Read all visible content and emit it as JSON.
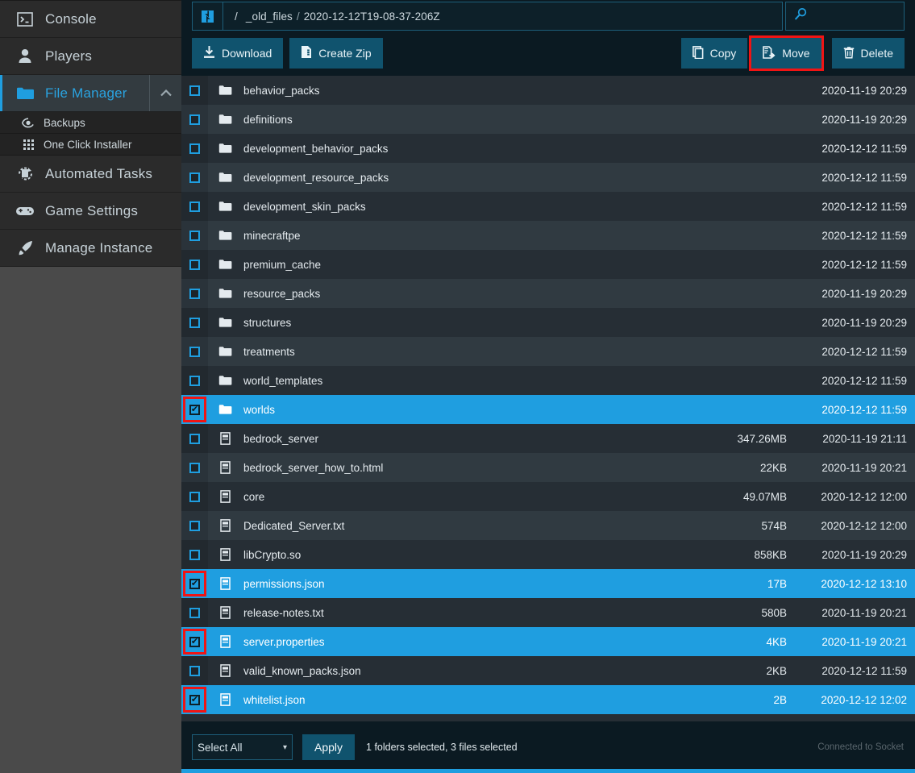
{
  "sidebar": {
    "items": [
      {
        "label": "Console",
        "icon": "console-icon",
        "active": false
      },
      {
        "label": "Players",
        "icon": "user-icon",
        "active": false
      },
      {
        "label": "File Manager",
        "icon": "folder-icon",
        "active": true
      },
      {
        "label": "Automated Tasks",
        "icon": "tasks-icon",
        "active": false
      },
      {
        "label": "Game Settings",
        "icon": "gamepad-icon",
        "active": false
      },
      {
        "label": "Manage Instance",
        "icon": "rocket-icon",
        "active": false
      }
    ],
    "subitems": [
      {
        "label": "Backups",
        "icon": "backup-icon"
      },
      {
        "label": "One Click Installer",
        "icon": "grid-icon"
      }
    ]
  },
  "breadcrumb": {
    "refresh_icon": "refresh-icon",
    "root": "/",
    "segments": [
      "_old_files",
      "2020-12-12T19-08-37-206Z"
    ],
    "separator": "/"
  },
  "search": {
    "icon": "search-icon",
    "value": "",
    "placeholder": ""
  },
  "toolbar": {
    "download_label": "Download",
    "download_icon": "download-icon",
    "create_zip_label": "Create Zip",
    "create_zip_icon": "zip-icon",
    "copy_label": "Copy",
    "copy_icon": "copy-icon",
    "move_label": "Move",
    "move_icon": "move-icon",
    "delete_label": "Delete",
    "delete_icon": "trash-icon",
    "highlighted_button": "Move",
    "highlight_color": "#f01414"
  },
  "files": [
    {
      "name": "behavior_packs",
      "type": "folder",
      "size": "",
      "date": "2020-11-19 20:29",
      "selected": false,
      "highlighted": false
    },
    {
      "name": "definitions",
      "type": "folder",
      "size": "",
      "date": "2020-11-19 20:29",
      "selected": false,
      "highlighted": false
    },
    {
      "name": "development_behavior_packs",
      "type": "folder",
      "size": "",
      "date": "2020-12-12 11:59",
      "selected": false,
      "highlighted": false
    },
    {
      "name": "development_resource_packs",
      "type": "folder",
      "size": "",
      "date": "2020-12-12 11:59",
      "selected": false,
      "highlighted": false
    },
    {
      "name": "development_skin_packs",
      "type": "folder",
      "size": "",
      "date": "2020-12-12 11:59",
      "selected": false,
      "highlighted": false
    },
    {
      "name": "minecraftpe",
      "type": "folder",
      "size": "",
      "date": "2020-12-12 11:59",
      "selected": false,
      "highlighted": false
    },
    {
      "name": "premium_cache",
      "type": "folder",
      "size": "",
      "date": "2020-12-12 11:59",
      "selected": false,
      "highlighted": false
    },
    {
      "name": "resource_packs",
      "type": "folder",
      "size": "",
      "date": "2020-11-19 20:29",
      "selected": false,
      "highlighted": false
    },
    {
      "name": "structures",
      "type": "folder",
      "size": "",
      "date": "2020-11-19 20:29",
      "selected": false,
      "highlighted": false
    },
    {
      "name": "treatments",
      "type": "folder",
      "size": "",
      "date": "2020-12-12 11:59",
      "selected": false,
      "highlighted": false
    },
    {
      "name": "world_templates",
      "type": "folder",
      "size": "",
      "date": "2020-12-12 11:59",
      "selected": false,
      "highlighted": false
    },
    {
      "name": "worlds",
      "type": "folder",
      "size": "",
      "date": "2020-12-12 11:59",
      "selected": true,
      "highlighted": true
    },
    {
      "name": "bedrock_server",
      "type": "file",
      "size": "347.26MB",
      "date": "2020-11-19 21:11",
      "selected": false,
      "highlighted": false
    },
    {
      "name": "bedrock_server_how_to.html",
      "type": "file",
      "size": "22KB",
      "date": "2020-11-19 20:21",
      "selected": false,
      "highlighted": false
    },
    {
      "name": "core",
      "type": "file",
      "size": "49.07MB",
      "date": "2020-12-12 12:00",
      "selected": false,
      "highlighted": false
    },
    {
      "name": "Dedicated_Server.txt",
      "type": "file",
      "size": "574B",
      "date": "2020-12-12 12:00",
      "selected": false,
      "highlighted": false
    },
    {
      "name": "libCrypto.so",
      "type": "file",
      "size": "858KB",
      "date": "2020-11-19 20:29",
      "selected": false,
      "highlighted": false
    },
    {
      "name": "permissions.json",
      "type": "file",
      "size": "17B",
      "date": "2020-12-12 13:10",
      "selected": true,
      "highlighted": true
    },
    {
      "name": "release-notes.txt",
      "type": "file",
      "size": "580B",
      "date": "2020-11-19 20:21",
      "selected": false,
      "highlighted": false
    },
    {
      "name": "server.properties",
      "type": "file",
      "size": "4KB",
      "date": "2020-11-19 20:21",
      "selected": true,
      "highlighted": true
    },
    {
      "name": "valid_known_packs.json",
      "type": "file",
      "size": "2KB",
      "date": "2020-12-12 11:59",
      "selected": false,
      "highlighted": false
    },
    {
      "name": "whitelist.json",
      "type": "file",
      "size": "2B",
      "date": "2020-12-12 12:02",
      "selected": true,
      "highlighted": true
    }
  ],
  "footer": {
    "select_value": "Select All",
    "select_options": [
      "Select All"
    ],
    "caret_icon": "chevron-down-icon",
    "apply_label": "Apply",
    "selection_status": "1 folders selected, 3 files selected",
    "socket_status": "Connected to Socket"
  },
  "colors": {
    "accent": "#1f9ee0",
    "button": "#10536e",
    "highlight": "#f01414",
    "row_odd": "#262e35",
    "row_even": "#303a41"
  }
}
